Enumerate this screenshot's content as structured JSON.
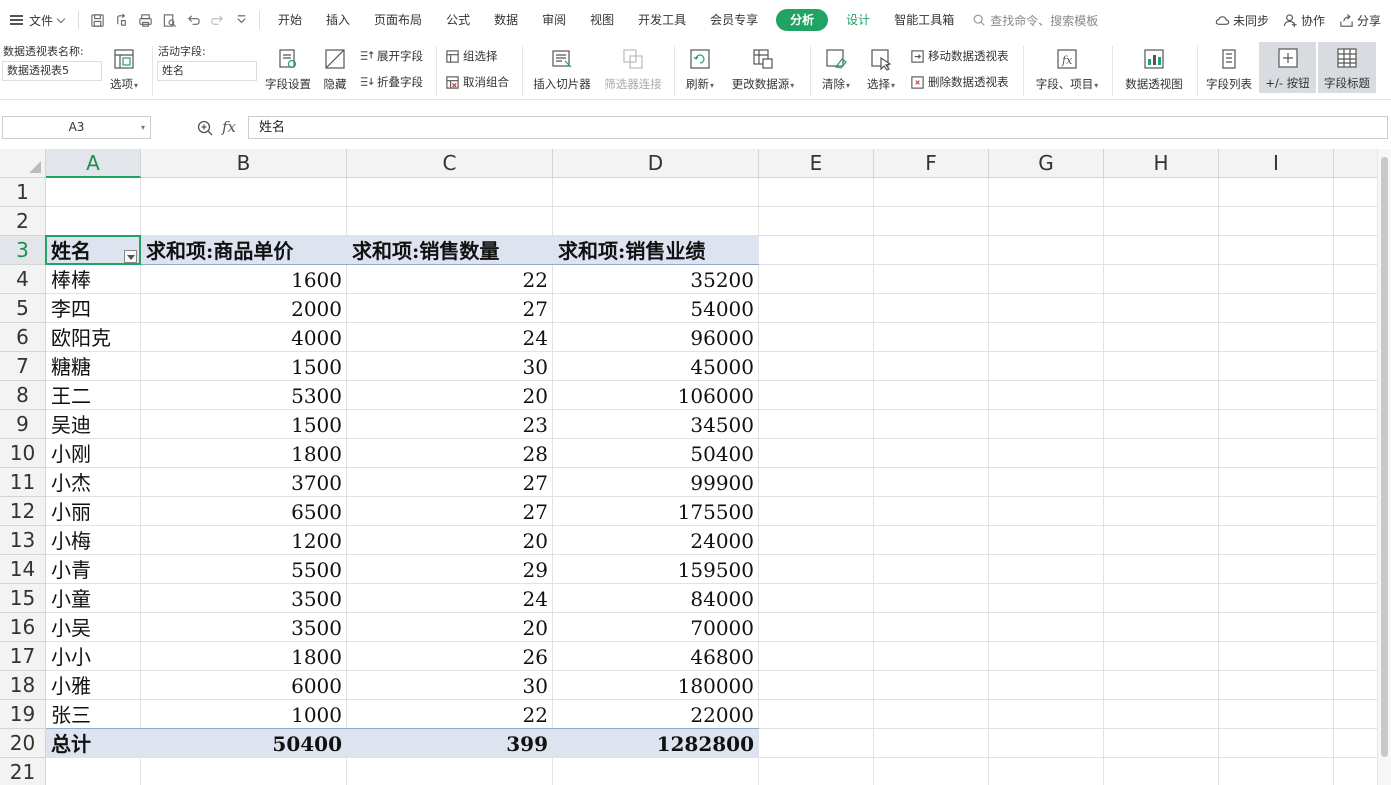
{
  "menubar": {
    "file_label": "文件",
    "tabs": [
      {
        "label": "开始"
      },
      {
        "label": "插入"
      },
      {
        "label": "页面布局"
      },
      {
        "label": "公式"
      },
      {
        "label": "数据"
      },
      {
        "label": "审阅"
      },
      {
        "label": "视图"
      },
      {
        "label": "开发工具"
      },
      {
        "label": "会员专享"
      },
      {
        "label": "分析"
      },
      {
        "label": "设计"
      },
      {
        "label": "智能工具箱"
      }
    ],
    "search_placeholder": "查找命令、搜索模板",
    "sync_label": "未同步",
    "collab_label": "协作",
    "share_label": "分享"
  },
  "ribbon": {
    "pivot_name_label": "数据透视表名称:",
    "pivot_name_value": "数据透视表5",
    "options_label": "选项",
    "active_field_label": "活动字段:",
    "active_field_value": "姓名",
    "field_settings_label": "字段设置",
    "hide_label": "隐藏",
    "expand_field_label": "展开字段",
    "collapse_field_label": "折叠字段",
    "group_selection_label": "组选择",
    "ungroup_label": "取消组合",
    "insert_slicer_label": "插入切片器",
    "filter_connections_label": "筛选器连接",
    "refresh_label": "刷新",
    "change_source_label": "更改数据源",
    "clear_label": "清除",
    "select_label": "选择",
    "move_pivot_label": "移动数据透视表",
    "delete_pivot_label": "删除数据透视表",
    "fields_items_label": "字段、项目",
    "pivot_chart_label": "数据透视图",
    "field_list_label": "字段列表",
    "plus_minus_label": "+/- 按钮",
    "field_headers_label": "字段标题"
  },
  "formula_bar": {
    "cell_ref": "A3",
    "fx_label": "fx",
    "formula": "姓名"
  },
  "sheet": {
    "columns": [
      "A",
      "B",
      "C",
      "D",
      "E",
      "F",
      "G",
      "H",
      "I"
    ],
    "rows": [
      "1",
      "2",
      "3",
      "4",
      "5",
      "6",
      "7",
      "8",
      "9",
      "10",
      "11",
      "12",
      "13",
      "14",
      "15",
      "16",
      "17",
      "18",
      "19",
      "20",
      "21"
    ],
    "selected_cell": "A3"
  },
  "pivot": {
    "headers": [
      "姓名",
      "求和项:商品单价",
      "求和项:销售数量",
      "求和项:销售业绩"
    ],
    "rows": [
      [
        "棒棒",
        "1600",
        "22",
        "35200"
      ],
      [
        "李四",
        "2000",
        "27",
        "54000"
      ],
      [
        "欧阳克",
        "4000",
        "24",
        "96000"
      ],
      [
        "糖糖",
        "1500",
        "30",
        "45000"
      ],
      [
        "王二",
        "5300",
        "20",
        "106000"
      ],
      [
        "吴迪",
        "1500",
        "23",
        "34500"
      ],
      [
        "小刚",
        "1800",
        "28",
        "50400"
      ],
      [
        "小杰",
        "3700",
        "27",
        "99900"
      ],
      [
        "小丽",
        "6500",
        "27",
        "175500"
      ],
      [
        "小梅",
        "1200",
        "20",
        "24000"
      ],
      [
        "小青",
        "5500",
        "29",
        "159500"
      ],
      [
        "小童",
        "3500",
        "24",
        "84000"
      ],
      [
        "小吴",
        "3500",
        "20",
        "70000"
      ],
      [
        "小小",
        "1800",
        "26",
        "46800"
      ],
      [
        "小雅",
        "6000",
        "30",
        "180000"
      ],
      [
        "张三",
        "1000",
        "22",
        "22000"
      ]
    ],
    "total": [
      "总计",
      "50400",
      "399",
      "1282800"
    ]
  },
  "colors": {
    "accent": "#21a366",
    "pivot_band": "#dde4f0",
    "pivot_line": "#95a9c9"
  }
}
